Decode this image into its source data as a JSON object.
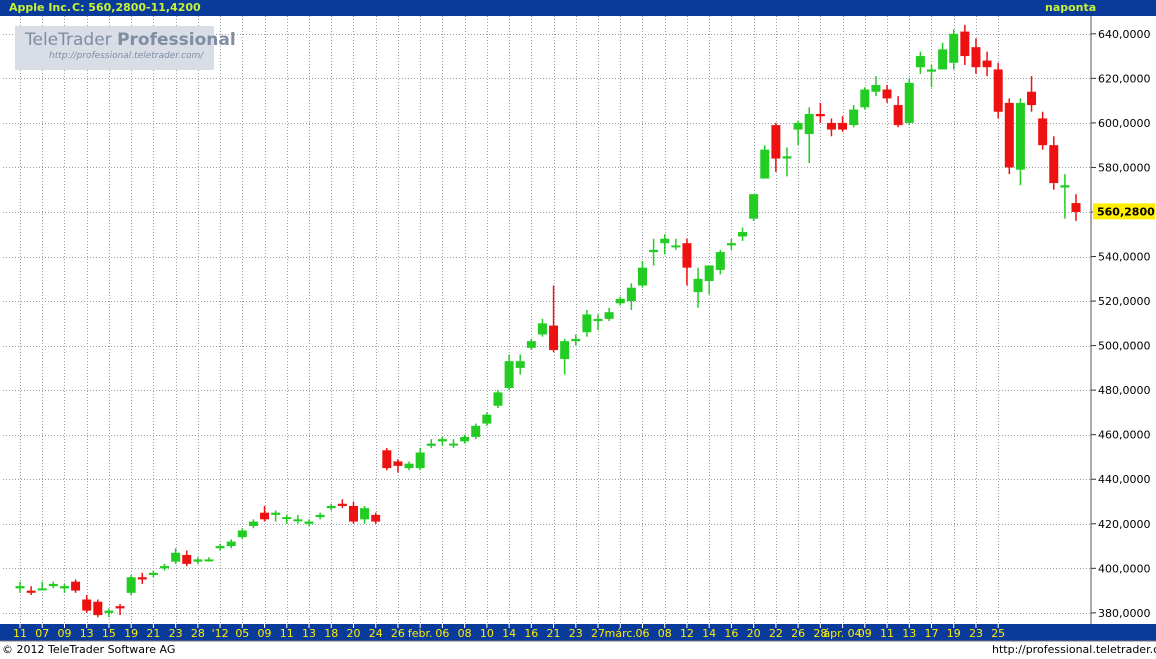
{
  "header": {
    "symbol": "Apple Inc.",
    "close_text": "C: 560,2800",
    "change_text": "-11,4200",
    "period": "naponta"
  },
  "logo": {
    "brand_light": "TeleTrader ",
    "brand_bold": "Professional",
    "url": "http://professional.teletrader.com/"
  },
  "footer": {
    "copyright": "© 2012 TeleTrader Software AG",
    "url": "http://professional.teletrader.com/"
  },
  "colors": {
    "header_bg": "#0a3a9a",
    "header_text": "#c7f23a",
    "up": "#22cc22",
    "down": "#ee1111",
    "axis_bg": "#0a3a9a",
    "axis_text": "#ffee00",
    "grid": "#9aa0a6",
    "last_price_bg": "#ffee00"
  },
  "chart_data": {
    "type": "candlestick",
    "ylim": [
      375,
      648
    ],
    "y_ticks": [
      380,
      400,
      420,
      440,
      460,
      480,
      500,
      520,
      540,
      560,
      580,
      600,
      620,
      640
    ],
    "y_tick_labels": [
      "380,0000",
      "400,0000",
      "420,0000",
      "440,0000",
      "460,0000",
      "480,0000",
      "500,0000",
      "520,0000",
      "540,0000",
      "560,0000",
      "580,0000",
      "600,0000",
      "620,0000",
      "640,0000"
    ],
    "last_price": 560.28,
    "last_price_label": "560,2800",
    "x_labels": [
      "11",
      "07",
      "09",
      "13",
      "15",
      "19",
      "21",
      "23",
      "28",
      "'12",
      "05",
      "09",
      "11",
      "13",
      "18",
      "20",
      "24",
      "26",
      "febr.",
      "06",
      "08",
      "10",
      "14",
      "16",
      "21",
      "23",
      "27",
      "márc.",
      "06",
      "08",
      "12",
      "14",
      "16",
      "20",
      "22",
      "26",
      "28",
      "ápr. 04",
      "09",
      "11",
      "13",
      "17",
      "19",
      "23",
      "25"
    ],
    "x_label_index": [
      0,
      2,
      4,
      6,
      8,
      10,
      12,
      14,
      16,
      18,
      20,
      22,
      24,
      26,
      28,
      30,
      32,
      34,
      36,
      38,
      40,
      42,
      44,
      46,
      48,
      50,
      52,
      54,
      56,
      58,
      60,
      62,
      64,
      66,
      68,
      70,
      72,
      74,
      76,
      78,
      80,
      82,
      84,
      86,
      88
    ],
    "ohlc": [
      [
        391,
        394,
        389,
        392
      ],
      [
        390,
        392,
        388,
        389
      ],
      [
        391,
        394,
        390,
        391
      ],
      [
        392,
        394,
        391,
        393
      ],
      [
        391,
        393,
        389,
        392
      ],
      [
        394,
        395,
        389,
        390
      ],
      [
        386,
        388,
        380,
        381
      ],
      [
        385,
        386,
        378,
        379
      ],
      [
        380,
        382,
        378,
        381
      ],
      [
        383,
        384,
        379,
        382
      ],
      [
        389,
        397,
        388,
        396
      ],
      [
        396,
        398,
        393,
        395
      ],
      [
        397,
        399,
        396,
        398
      ],
      [
        400,
        402,
        399,
        401
      ],
      [
        403,
        409,
        402,
        407
      ],
      [
        406,
        408,
        401,
        402
      ],
      [
        403,
        405,
        402,
        404
      ],
      [
        404,
        405,
        403,
        404
      ],
      [
        409,
        411,
        408,
        410
      ],
      [
        410,
        413,
        409,
        412
      ],
      [
        414,
        418,
        413,
        417
      ],
      [
        419,
        422,
        418,
        421
      ],
      [
        425,
        428,
        421,
        422
      ],
      [
        424,
        426,
        421,
        425
      ],
      [
        423,
        424,
        420,
        423
      ],
      [
        422,
        424,
        420,
        422
      ],
      [
        420,
        422,
        419,
        421
      ],
      [
        423,
        425,
        422,
        424
      ],
      [
        427,
        429,
        426,
        428
      ],
      [
        429,
        431,
        427,
        428
      ],
      [
        428,
        430,
        420,
        421
      ],
      [
        422,
        428,
        420,
        427
      ],
      [
        424,
        425,
        420,
        421
      ],
      [
        453,
        454,
        444,
        445
      ],
      [
        448,
        449,
        443,
        446
      ],
      [
        445,
        448,
        444,
        447
      ],
      [
        445,
        454,
        444,
        452
      ],
      [
        455,
        458,
        454,
        456
      ],
      [
        457,
        459,
        455,
        458
      ],
      [
        456,
        458,
        454,
        456
      ],
      [
        457,
        460,
        456,
        459
      ],
      [
        459,
        465,
        458,
        464
      ],
      [
        465,
        470,
        464,
        469
      ],
      [
        473,
        480,
        472,
        479
      ],
      [
        481,
        496,
        480,
        493
      ],
      [
        490,
        496,
        487,
        493
      ],
      [
        499,
        503,
        498,
        502
      ],
      [
        505,
        512,
        504,
        510
      ],
      [
        509,
        527,
        497,
        498
      ],
      [
        494,
        503,
        487,
        502
      ],
      [
        502,
        505,
        500,
        503
      ],
      [
        506,
        516,
        504,
        514
      ],
      [
        511,
        514,
        507,
        512
      ],
      [
        512,
        517,
        511,
        515
      ],
      [
        519,
        522,
        518,
        521
      ],
      [
        520,
        528,
        516,
        526
      ],
      [
        527,
        538,
        526,
        535
      ],
      [
        542,
        548,
        536,
        543
      ],
      [
        546,
        550,
        541,
        548
      ],
      [
        545,
        548,
        543,
        545
      ],
      [
        546,
        548,
        527,
        535
      ],
      [
        524,
        535,
        517,
        530
      ],
      [
        529,
        535,
        523,
        536
      ],
      [
        534,
        543,
        532,
        542
      ],
      [
        545,
        548,
        543,
        546
      ],
      [
        549,
        553,
        547,
        551
      ],
      [
        557,
        568,
        556,
        568
      ],
      [
        575,
        590,
        575,
        588
      ],
      [
        599,
        600,
        578,
        584
      ],
      [
        584,
        589,
        576,
        585
      ],
      [
        597,
        601,
        590,
        600
      ],
      [
        595,
        607,
        582,
        604
      ],
      [
        604,
        609,
        600,
        603
      ],
      [
        600,
        602,
        594,
        597
      ],
      [
        600,
        603,
        596,
        597
      ],
      [
        599,
        608,
        598,
        606
      ],
      [
        607,
        616,
        606,
        615
      ],
      [
        614,
        621,
        612,
        617
      ],
      [
        615,
        617,
        609,
        611
      ],
      [
        608,
        612,
        598,
        599
      ],
      [
        600,
        620,
        599,
        618
      ],
      [
        625,
        632,
        622,
        630
      ],
      [
        623,
        626,
        616,
        624
      ],
      [
        624,
        636,
        624,
        633
      ],
      [
        627,
        642,
        624,
        640
      ],
      [
        641,
        644,
        626,
        630
      ],
      [
        634,
        638,
        622,
        625
      ],
      [
        628,
        632,
        621,
        625
      ],
      [
        624,
        627,
        602,
        605
      ],
      [
        609,
        611,
        577,
        580
      ],
      [
        579,
        611,
        572,
        609
      ],
      [
        614,
        621,
        605,
        608
      ],
      [
        602,
        605,
        588,
        590
      ],
      [
        590,
        594,
        570,
        573
      ],
      [
        571,
        577,
        557,
        572
      ],
      [
        564,
        568,
        556,
        560
      ]
    ]
  }
}
